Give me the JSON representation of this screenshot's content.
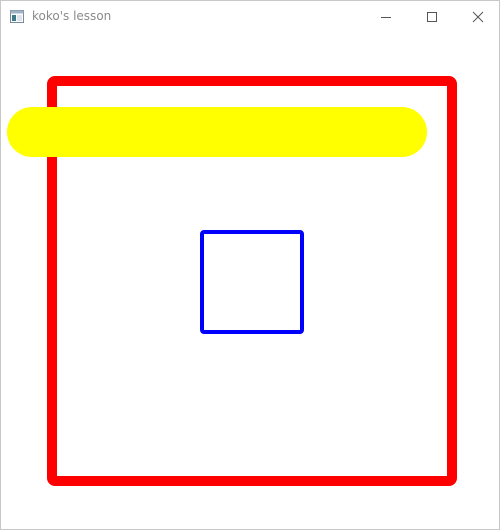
{
  "window": {
    "title": "koko's lesson"
  },
  "titlebar": {
    "icons": {
      "app": "app-window-icon",
      "minimize": "minimize-icon",
      "maximize": "maximize-icon",
      "close": "close-icon"
    }
  },
  "drawing": {
    "shapes": [
      {
        "name": "red-rectangle",
        "kind": "rectangle-outline",
        "color": "#ff0000"
      },
      {
        "name": "yellow-bar",
        "kind": "rounded-line",
        "color": "#ffff00"
      },
      {
        "name": "blue-square",
        "kind": "rectangle-outline",
        "color": "#0000ff"
      }
    ]
  }
}
